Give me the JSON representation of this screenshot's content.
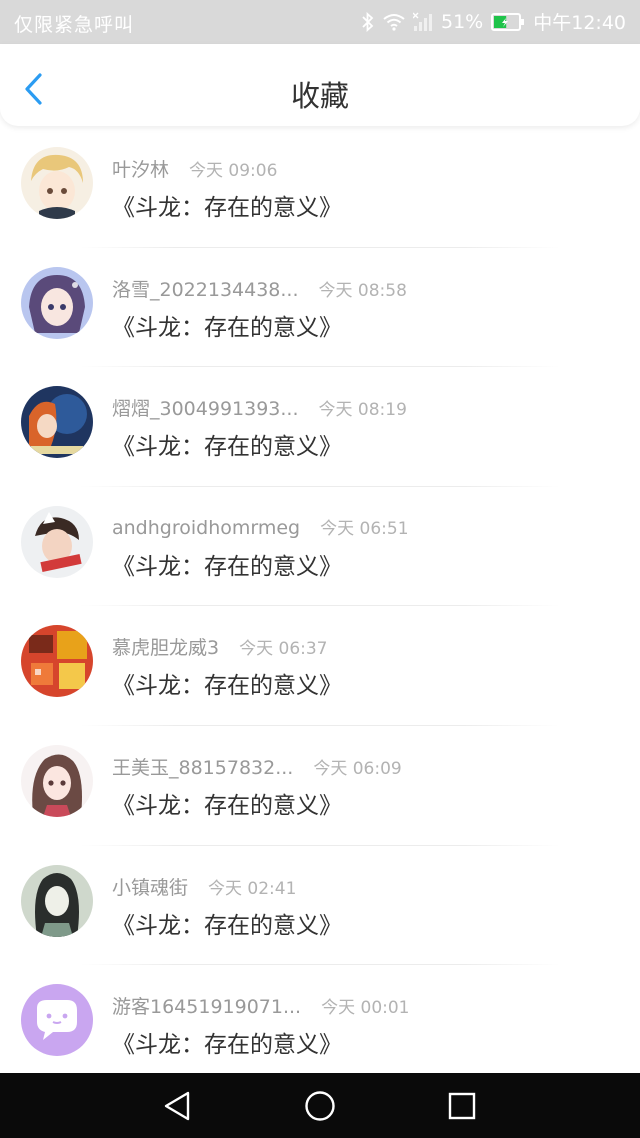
{
  "status_bar": {
    "carrier_text": "仅限紧急呼叫",
    "battery_percent": "51%",
    "clock": "中午12:40",
    "battery_level": 0.51,
    "icons": [
      "bluetooth-icon",
      "wifi-icon",
      "signal-icon",
      "battery-icon"
    ]
  },
  "header": {
    "title": "收藏",
    "back_icon": "chevron-left-icon",
    "accent_color": "#2b9cf2"
  },
  "favorites": [
    {
      "username": "叶汐林",
      "time": "今天 09:06",
      "book": "《斗龙：存在的意义》"
    },
    {
      "username": "洛雪_2022134438...",
      "time": "今天 08:58",
      "book": "《斗龙：存在的意义》"
    },
    {
      "username": "熠熠_3004991393...",
      "time": "今天 08:19",
      "book": "《斗龙：存在的意义》"
    },
    {
      "username": "andhgroidhomrmeg",
      "time": "今天 06:51",
      "book": "《斗龙：存在的意义》"
    },
    {
      "username": "慕虎胆龙威3",
      "time": "今天 06:37",
      "book": "《斗龙：存在的意义》"
    },
    {
      "username": "王美玉_88157832...",
      "time": "今天 06:09",
      "book": "《斗龙：存在的意义》"
    },
    {
      "username": "小镇魂街",
      "time": "今天 02:41",
      "book": "《斗龙：存在的意义》"
    },
    {
      "username": "游客16451919071...",
      "time": "今天 00:01",
      "book": "《斗龙：存在的意义》"
    }
  ],
  "nav_bar": {
    "icons": [
      "nav-back-icon",
      "nav-home-icon",
      "nav-recent-icon"
    ]
  }
}
